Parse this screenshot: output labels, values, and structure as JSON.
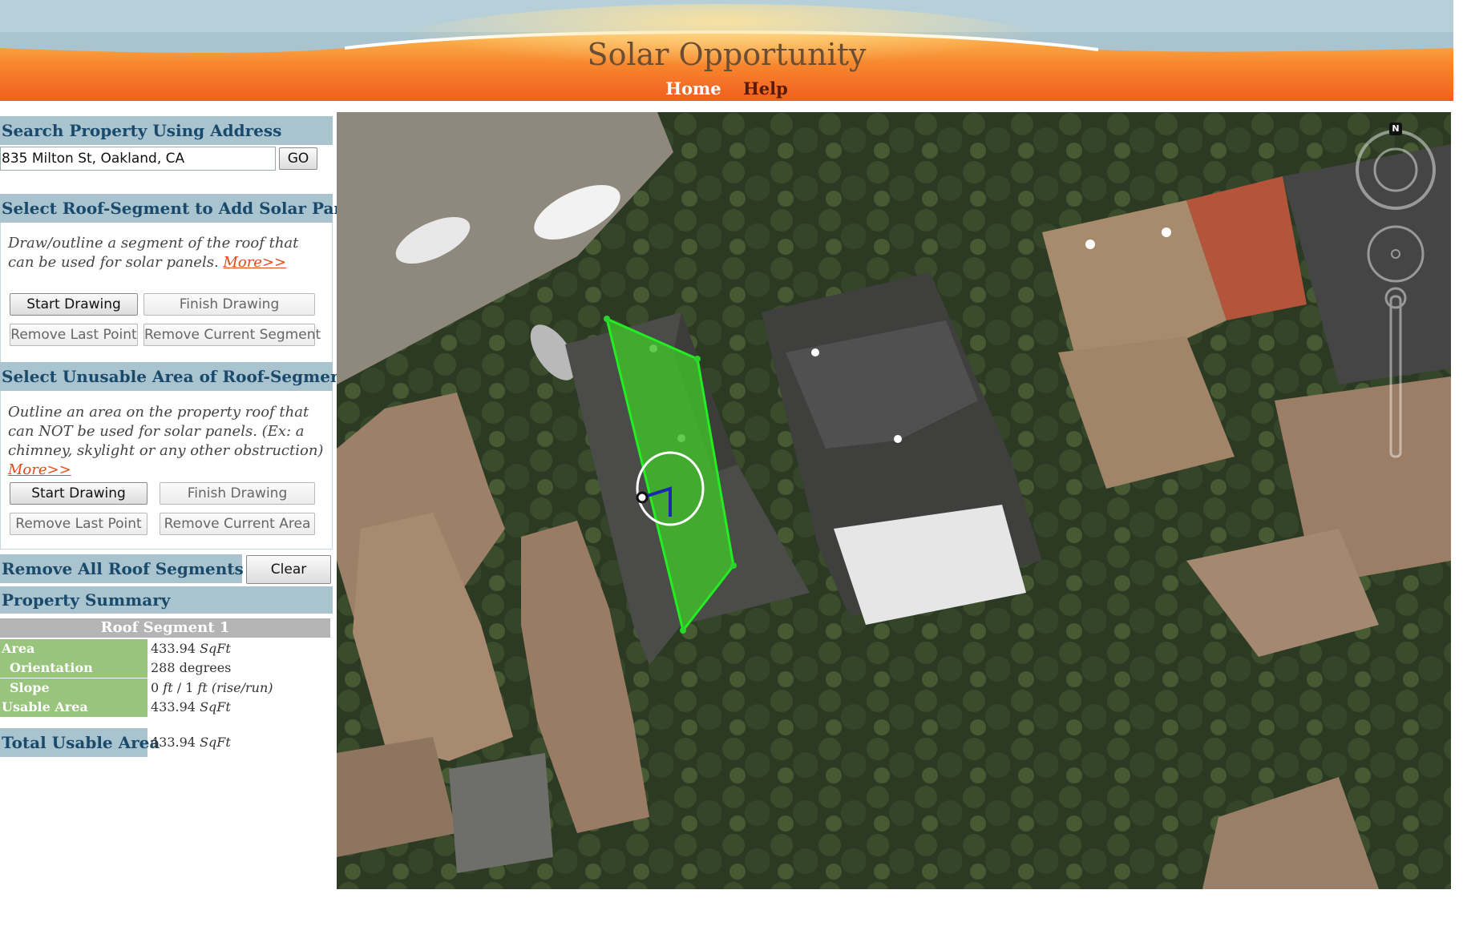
{
  "header": {
    "title": "Solar Opportunity",
    "nav": {
      "home": "Home",
      "help": "Help"
    }
  },
  "search": {
    "heading": "Search Property Using Address",
    "address_value": "835 Milton St, Oakland, CA",
    "go_label": "GO"
  },
  "roof_segment": {
    "heading": "Select Roof-Segment to Add Solar Panels",
    "description": "Draw/outline a segment of the roof that can be used for solar panels.",
    "more_link": "More>>",
    "start_drawing": "Start Drawing",
    "finish_drawing": "Finish Drawing",
    "remove_last_point": "Remove Last Point",
    "remove_current_segment": "Remove Current Segment"
  },
  "unusable_area": {
    "heading": "Select Unusable Area of Roof-Segment",
    "description": "Outline an area on the property roof that can NOT be used for solar panels. (Ex: a chimney, skylight or any other obstruction)",
    "more_link": "More>>",
    "start_drawing": "Start Drawing",
    "finish_drawing": "Finish Drawing",
    "remove_last_point": "Remove Last Point",
    "remove_current_area": "Remove Current Area"
  },
  "remove_all": {
    "label": "Remove All Roof Segments",
    "clear_label": "Clear"
  },
  "summary": {
    "heading": "Property Summary",
    "segment_title": "Roof Segment 1",
    "area_label": "Area",
    "area_value": "433.94",
    "area_unit": "SqFt",
    "orientation_label": "Orientation",
    "orientation_value": "288 degrees",
    "slope_label": "Slope",
    "slope_value_a": "0",
    "slope_unit_a": "ft",
    "slope_sep": " / ",
    "slope_value_b": "1",
    "slope_unit_b": "ft (rise/run)",
    "usable_label": "Usable Area",
    "usable_value": "433.94",
    "usable_unit": "SqFt",
    "total_label": "Total Usable Area",
    "total_value": "433.94",
    "total_unit": "SqFt"
  },
  "map": {
    "compass_letter": "N",
    "segment_fill": "#3fbf2a",
    "segment_stroke": "#22ee22"
  },
  "colors": {
    "header_orange": "#f26522",
    "header_blue": "#a9c4cf",
    "section_head_text": "#1a4a6b",
    "summary_label_bg": "#98c47e",
    "more_link": "#e4481d"
  }
}
